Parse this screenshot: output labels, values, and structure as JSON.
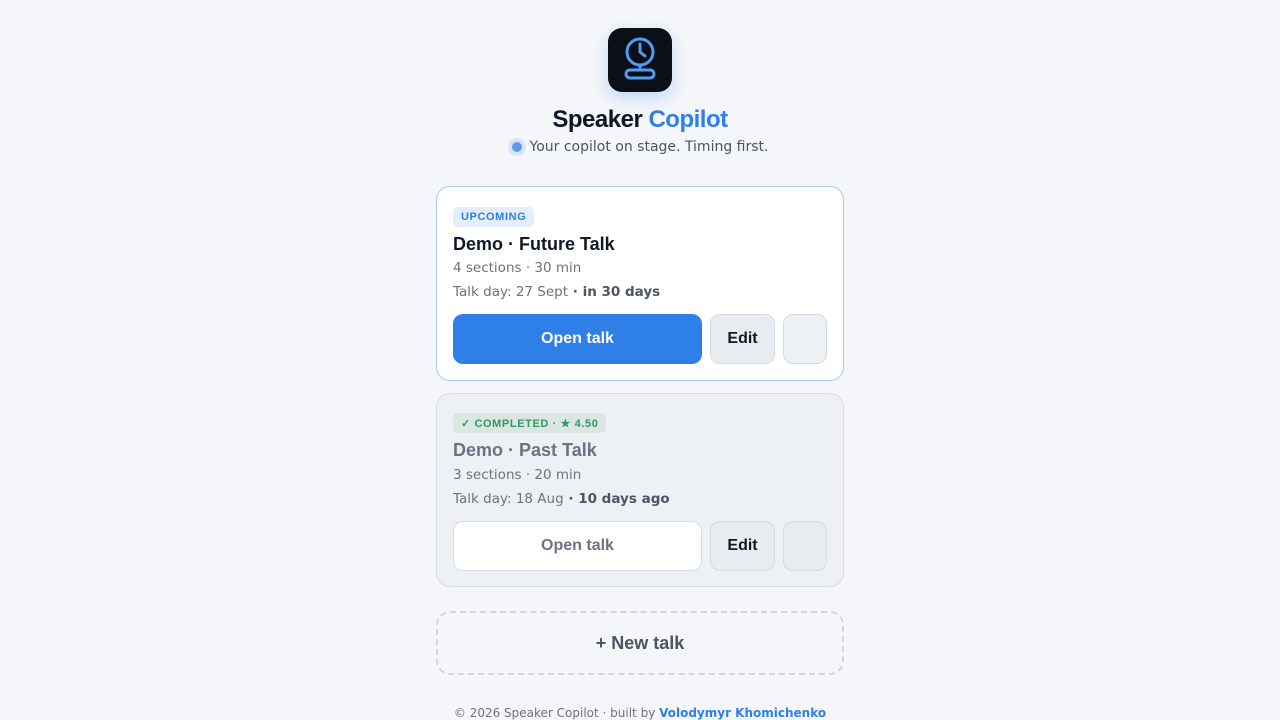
{
  "app": {
    "icon": "clock-stand-icon",
    "brand_word1": "Speaker",
    "brand_word2": "Copilot",
    "tagline": "Your copilot on stage. Timing first.",
    "accent_color": "#2e7fe8"
  },
  "talks": [
    {
      "status": "UPCOMING",
      "title": "Demo · Future Talk",
      "summary": "4 sections · 30 min",
      "talk_day": "Talk day: 27 Sept",
      "relative": " · in 30 days",
      "open_label": "Open talk",
      "edit_label": "Edit"
    },
    {
      "status": "✓ COMPLETED · ★ 4.50",
      "title": "Demo · Past Talk",
      "summary": "3 sections · 20 min",
      "talk_day": "Talk day: 18 Aug",
      "relative": " · 10 days ago",
      "open_label": "Open talk",
      "edit_label": "Edit"
    }
  ],
  "new_talk_label": "+ New talk",
  "footer": {
    "text": "© 2026 Speaker Copilot · built by ",
    "author": "Volodymyr Khomichenko"
  }
}
